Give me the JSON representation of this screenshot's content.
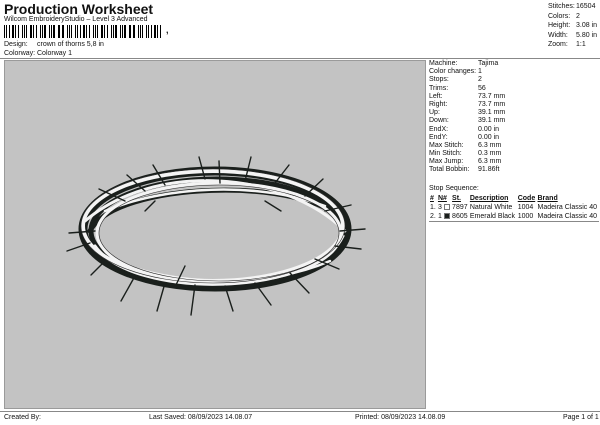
{
  "header": {
    "title": "Production Worksheet",
    "subtitle": "Wilcom EmbroideryStudio – Level 3 Advanced",
    "barcode_tail": ","
  },
  "design_info": {
    "design_label": "Design:",
    "design_value": "crown of thorns 5,8 in",
    "colorway_label": "Colorway:",
    "colorway_value": "Colorway 1"
  },
  "summary": [
    {
      "label": "Stitches:",
      "value": "16504"
    },
    {
      "label": "Colors:",
      "value": "2"
    },
    {
      "label": "Height:",
      "value": "3.08 in"
    },
    {
      "label": "Width:",
      "value": "5.80 in"
    },
    {
      "label": "Zoom:",
      "value": "1:1"
    }
  ],
  "machine_specs": [
    {
      "label": "Machine:",
      "value": "Tajima"
    },
    {
      "label": "Color changes:",
      "value": "1"
    },
    {
      "label": "Stops:",
      "value": "2"
    },
    {
      "label": "Trims:",
      "value": "56"
    },
    {
      "label": "Left:",
      "value": "73.7 mm"
    },
    {
      "label": "Right:",
      "value": "73.7 mm"
    },
    {
      "label": "Up:",
      "value": "39.1 mm"
    },
    {
      "label": "Down:",
      "value": "39.1 mm"
    },
    {
      "label": "EndX:",
      "value": "0.00 in"
    },
    {
      "label": "EndY:",
      "value": "0.00 in"
    },
    {
      "label": "Max Stitch:",
      "value": "6.3 mm"
    },
    {
      "label": "Min Stitch:",
      "value": "0.3 mm"
    },
    {
      "label": "Max Jump:",
      "value": "6.3 mm"
    },
    {
      "label": "Total Bobbin:",
      "value": "91.86ft"
    }
  ],
  "stop_sequence": {
    "heading": "Stop Sequence:",
    "columns": [
      "#",
      "N#",
      "St.",
      "Description",
      "Code",
      "Brand"
    ],
    "rows": [
      {
        "num": "1.",
        "n": "3",
        "swatch": "#ffffff",
        "st": "7897",
        "desc": "Natural White",
        "code": "1004",
        "brand": "Madeira Classic 40"
      },
      {
        "num": "2.",
        "n": "1",
        "swatch": "#1a1f1c",
        "st": "8605",
        "desc": "Emerald Black",
        "code": "1000",
        "brand": "Madeira Classic 40"
      }
    ]
  },
  "footer": {
    "created": "Created By:",
    "saved": "Last Saved: 08/09/2023 14.08.07",
    "printed": "Printed: 08/09/2023 14.08.09",
    "page": "Page 1 of 1"
  },
  "colors": {
    "canvas_bg": "#c3c3c3",
    "thread_white": "#ffffff",
    "thread_black": "#1a1f1c"
  }
}
